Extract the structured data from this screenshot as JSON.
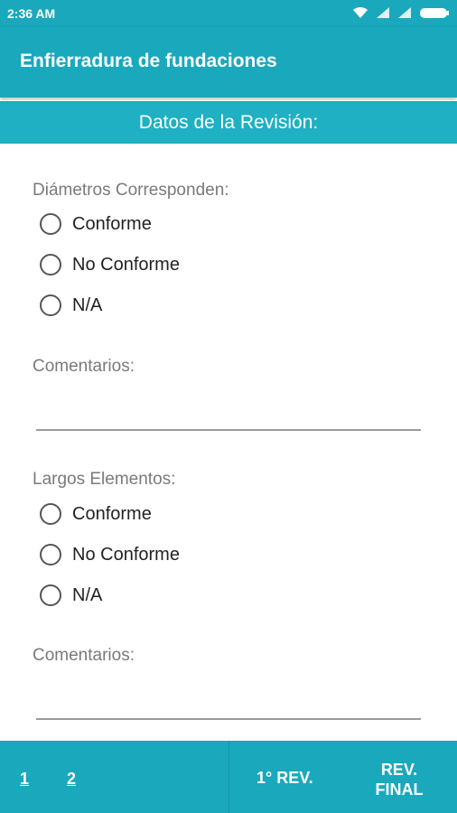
{
  "status_bar": {
    "time": "2:36 AM",
    "icons": [
      "wifi-icon",
      "signal-icon",
      "signal-icon",
      "battery-icon"
    ]
  },
  "app_bar": {
    "title": "Enfierradura de fundaciones"
  },
  "subheader": {
    "title": "Datos de la Revisión:"
  },
  "sections": [
    {
      "label": "Diámetros Corresponden:",
      "options": [
        "Conforme",
        "No Conforme",
        "N/A"
      ],
      "comment_label": "Comentarios:",
      "comment_value": ""
    },
    {
      "label": "Largos Elementos:",
      "options": [
        "Conforme",
        "No Conforme",
        "N/A"
      ],
      "comment_label": "Comentarios:",
      "comment_value": ""
    }
  ],
  "bottom_bar": {
    "pages": [
      "1",
      "2"
    ],
    "first_rev": "1° REV.",
    "final_rev_line1": "REV.",
    "final_rev_line2": "FINAL"
  },
  "colors": {
    "accent": "#1aa8bd",
    "subheader": "#1fb0c3"
  }
}
